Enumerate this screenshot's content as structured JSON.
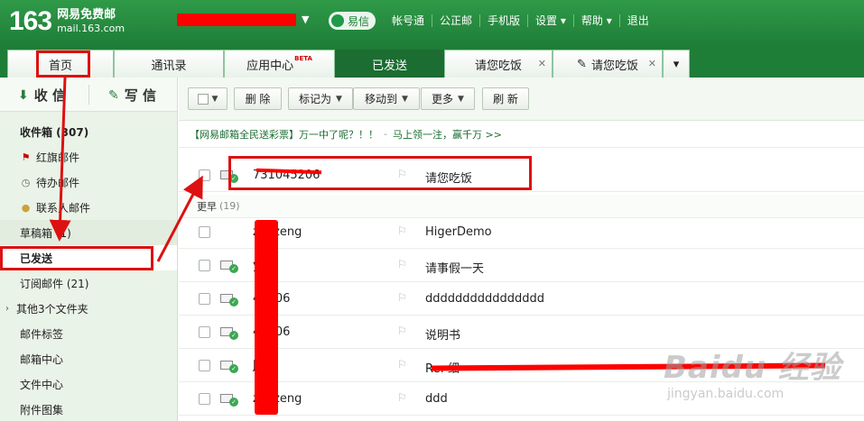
{
  "header": {
    "logo_num": "163",
    "logo_line1": "网易免费邮",
    "logo_line2": "mail.163.com",
    "yixin_label": "易信",
    "nav": [
      "帐号通",
      "公正邮",
      "手机版",
      "设置",
      "帮助",
      "退出"
    ]
  },
  "tabs": [
    {
      "label": "首页"
    },
    {
      "label": "通讯录"
    },
    {
      "label": "应用中心",
      "badge": "BETA"
    },
    {
      "label": "已发送"
    },
    {
      "label": "请您吃饭"
    },
    {
      "label": "请您吃饭"
    }
  ],
  "sidebar": {
    "receive_label": "收 信",
    "write_label": "写 信",
    "folders": [
      {
        "label": "收件箱 (307)"
      },
      {
        "label": "红旗邮件"
      },
      {
        "label": "待办邮件"
      },
      {
        "label": "联系人邮件"
      },
      {
        "label": "草稿箱 (1)"
      },
      {
        "label": "已发送"
      },
      {
        "label": "订阅邮件 (21)"
      },
      {
        "label": "其他3个文件夹"
      },
      {
        "label": "邮件标签"
      },
      {
        "label": "邮箱中心"
      },
      {
        "label": "文件中心"
      },
      {
        "label": "附件图集"
      }
    ]
  },
  "toolbar": {
    "delete_label": "删 除",
    "mark_label": "标记为",
    "move_label": "移动到",
    "more_label": "更多",
    "refresh_label": "刷 新"
  },
  "promo": {
    "text1": "【网易邮箱全民送彩票】万一中了呢？！！",
    "text2": "马上领一注，赢千万 >>"
  },
  "mail_list": {
    "top_row": {
      "from": "731045206",
      "subject": "请您吃饭"
    },
    "group_label": "更早",
    "group_count": "(19)",
    "rows": [
      {
        "from": "zenzeng",
        "subject": "HigerDemo"
      },
      {
        "from": "y",
        "subject": "请事假一天"
      },
      {
        "from": "45206",
        "subject": "dddddddddddddddd"
      },
      {
        "from": "45206",
        "subject": "说明书"
      },
      {
        "from": "Jin",
        "subject": "Re: 细"
      },
      {
        "from": "zenzeng",
        "subject": "ddd"
      }
    ]
  },
  "watermark": {
    "line1": "Baidu 经验",
    "line2": "jingyan.baidu.com"
  }
}
